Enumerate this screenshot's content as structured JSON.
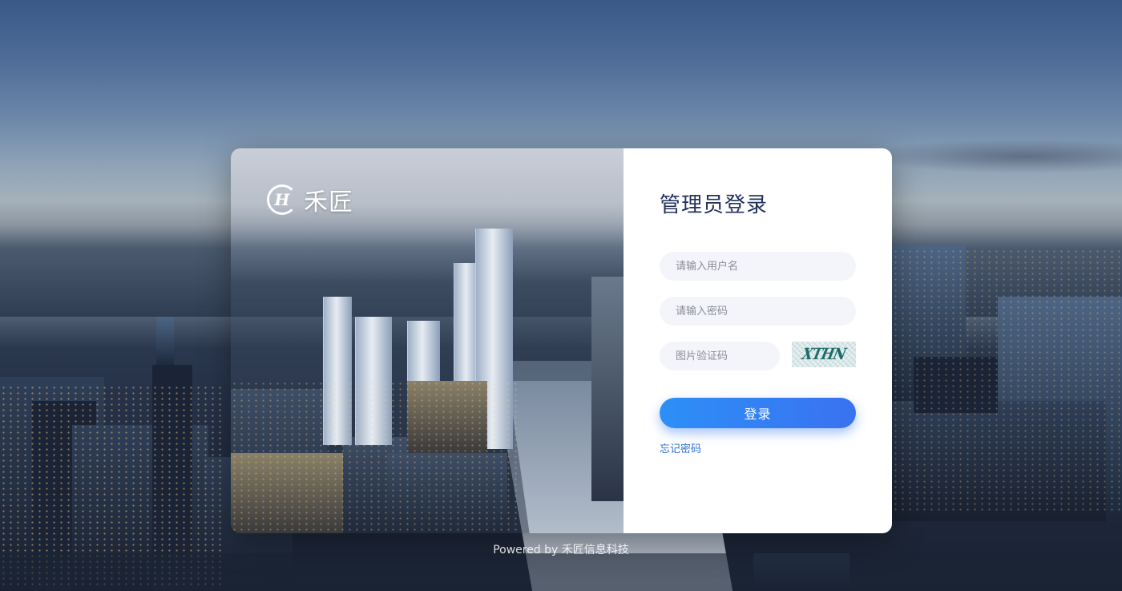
{
  "brand": {
    "logo_mark": "H",
    "name": "禾匠"
  },
  "login": {
    "title": "管理员登录",
    "username_placeholder": "请输入用户名",
    "password_placeholder": "请输入密码",
    "captcha_placeholder": "图片验证码",
    "captcha_text": "XTHN",
    "submit_label": "登录",
    "forgot_label": "忘记密码"
  },
  "footer": {
    "text": "Powered by 禾匠信息科技"
  },
  "colors": {
    "title": "#22305c",
    "button_start": "#2d8ff7",
    "button_end": "#3a72f0",
    "link": "#2b6fd8"
  }
}
